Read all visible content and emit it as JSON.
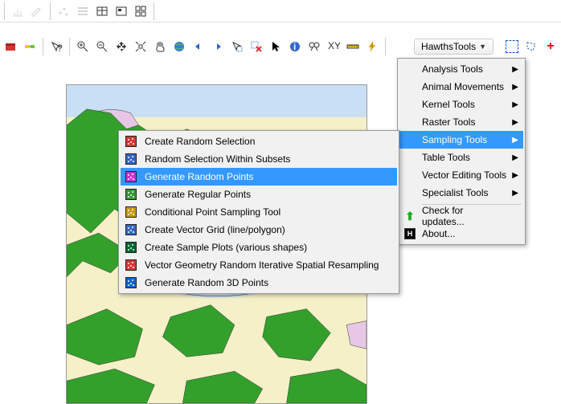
{
  "mainButton": {
    "label": "HawthsTools"
  },
  "mainMenu": {
    "items": [
      {
        "label": "Analysis Tools",
        "arrow": true
      },
      {
        "label": "Animal Movements",
        "arrow": true
      },
      {
        "label": "Kernel Tools",
        "arrow": true
      },
      {
        "label": "Raster Tools",
        "arrow": true
      },
      {
        "label": "Sampling Tools",
        "arrow": true,
        "highlight": true
      },
      {
        "label": "Table Tools",
        "arrow": true
      },
      {
        "label": "Vector Editing Tools",
        "arrow": true
      },
      {
        "label": "Specialist Tools",
        "arrow": true
      }
    ],
    "footer": [
      {
        "label": "Check for updates...",
        "icon": "update-icon"
      },
      {
        "label": "About...",
        "icon": "about-icon"
      }
    ]
  },
  "subMenu": {
    "items": [
      {
        "label": "Create Random Selection",
        "icon": "random-sel-icon"
      },
      {
        "label": "Random Selection Within Subsets",
        "icon": "subset-icon"
      },
      {
        "label": "Generate Random Points",
        "icon": "random-pts-icon",
        "highlight": true
      },
      {
        "label": "Generate Regular Points",
        "icon": "regular-pts-icon"
      },
      {
        "label": "Conditional Point Sampling Tool",
        "icon": "cond-pts-icon"
      },
      {
        "label": "Create Vector Grid (line/polygon)",
        "icon": "vector-grid-icon"
      },
      {
        "label": "Create Sample Plots (various shapes)",
        "icon": "sample-plots-icon"
      },
      {
        "label": "Vector Geometry Random Iterative Spatial Resampling",
        "icon": "vgriser-icon"
      },
      {
        "label": "Generate Random 3D Points",
        "icon": "random-3d-icon"
      }
    ]
  },
  "colors": {
    "water": "#c8dff5",
    "forest": "#33a02c",
    "bare": "#f5f0c8",
    "urban": "#e6c8e6"
  }
}
